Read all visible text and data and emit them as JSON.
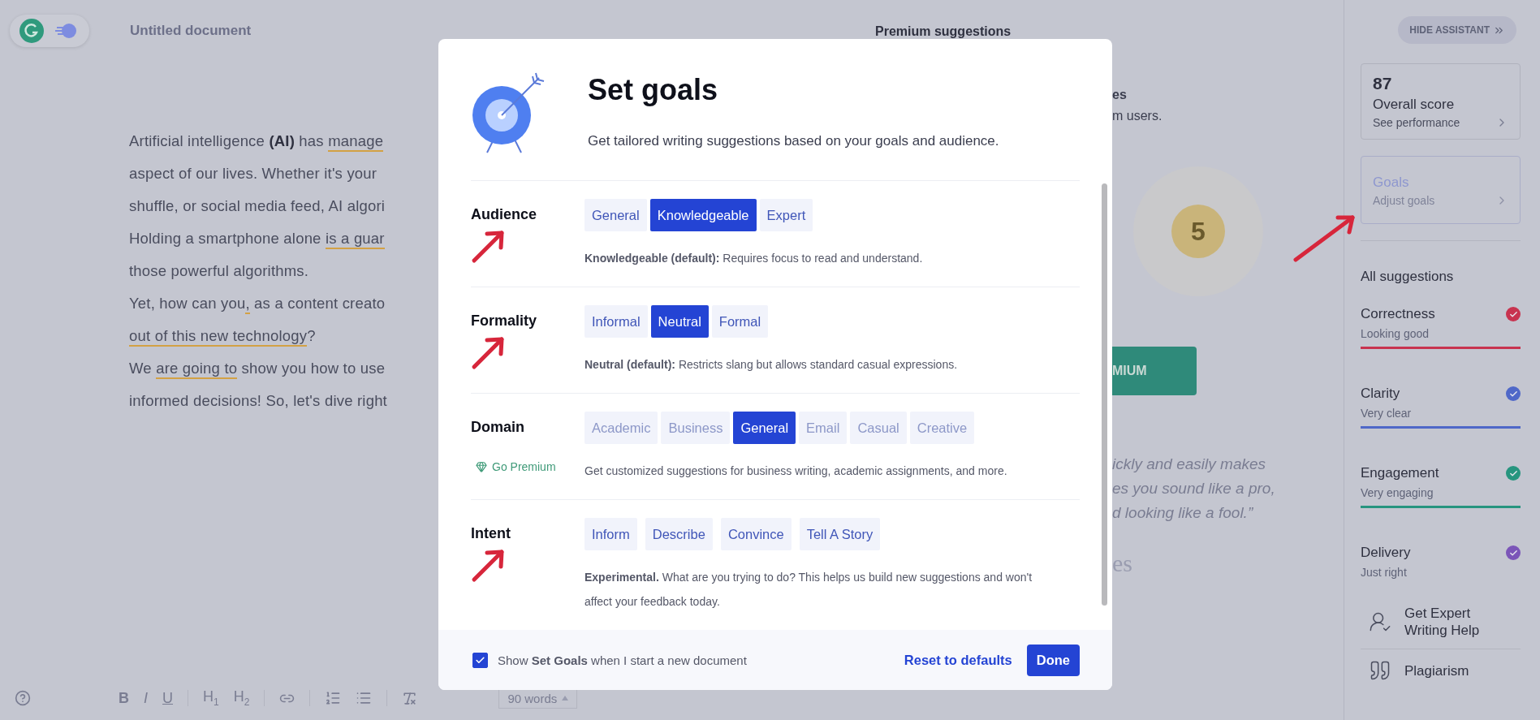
{
  "editor": {
    "document_title": "Untitled document",
    "lines": [
      [
        {
          "text": "Artificial intelligence **(AI)** has ",
          "flagged": false
        },
        {
          "text": "manage",
          "flagged": true
        }
      ],
      [
        {
          "text": "aspect of our lives. Whether it's your",
          "flagged": false
        }
      ],
      [
        {
          "text": "shuffle, or social media feed, AI algori",
          "flagged": false
        }
      ],
      [
        {
          "text": "Holding a smartphone alone ",
          "flagged": false
        },
        {
          "text": "is a guar",
          "flagged": true
        }
      ],
      [
        {
          "text": "those powerful algorithms.",
          "flagged": false
        }
      ],
      [
        {
          "text": "Yet, how can you",
          "flagged": false
        },
        {
          "text": ",",
          "flagged": true
        },
        {
          "text": " as a content creato",
          "flagged": false
        }
      ],
      [
        {
          "text": "out of this new technology",
          "flagged": true
        },
        {
          "text": "?",
          "flagged": false
        }
      ],
      [
        {
          "text": "We ",
          "flagged": false
        },
        {
          "text": "are going to",
          "flagged": true
        },
        {
          "text": " show you how to use",
          "flagged": false
        }
      ],
      [
        {
          "text": "informed decisions! So, let's dive right",
          "flagged": false
        }
      ]
    ],
    "format_buttons": [
      {
        "kind": "bold",
        "label": "B"
      },
      {
        "kind": "italic",
        "label": "I"
      },
      {
        "kind": "underline",
        "label": "U"
      },
      {
        "kind": "divider"
      },
      {
        "kind": "heading",
        "label": "H$_{1}$"
      },
      {
        "kind": "heading",
        "label": "H$_{2}$"
      },
      {
        "kind": "divider"
      },
      {
        "kind": "link"
      },
      {
        "kind": "divider"
      },
      {
        "kind": "numbered-list"
      },
      {
        "kind": "bullet-list"
      },
      {
        "kind": "divider"
      },
      {
        "kind": "clear"
      }
    ],
    "word_count": "90 words"
  },
  "premium_panel": {
    "heading": "Premium suggestions",
    "title_fragment": "es",
    "subtitle_fragment": "m users.",
    "count": "5",
    "button_fragment": "MIUM",
    "quote_lines": [
      "ickly and easily makes",
      "es you sound like a pro,",
      "d looking like a fool.”"
    ],
    "signature_fragment": "es"
  },
  "assistant": {
    "hide_button": "HIDE ASSISTANT",
    "score_card": {
      "score": "87",
      "label": "Overall score",
      "link": "See performance"
    },
    "goals_card": {
      "label": "Goals",
      "link": "Adjust goals",
      "annotated": true
    },
    "all_suggestions": "All suggestions",
    "categories": [
      {
        "name": "Correctness",
        "status": "Looking good",
        "color": "#c8334f",
        "underlined": true
      },
      {
        "name": "Clarity",
        "status": "Very clear",
        "color": "#4f68c8",
        "underlined": true
      },
      {
        "name": "Engagement",
        "status": "Very engaging",
        "color": "#27957f",
        "underlined": true
      },
      {
        "name": "Delivery",
        "status": "Just right",
        "color": "#7b55b8",
        "underlined": false
      }
    ],
    "extras": [
      {
        "kind": "expert",
        "label": "Get Expert Writing Help"
      },
      {
        "kind": "plagiarism",
        "label": "Plagiarism"
      }
    ]
  },
  "dialog": {
    "title": "Set goals",
    "subtitle": "Get tailored writing suggestions based on your goals and audience.",
    "sections": [
      {
        "label": "Audience",
        "kind": "joined",
        "disabled": false,
        "annotated": true,
        "options": [
          {
            "label": "General",
            "selected": false
          },
          {
            "label": "Knowledgeable",
            "selected": true
          },
          {
            "label": "Expert",
            "selected": false
          }
        ],
        "description": "**Knowledgeable (default):** Requires focus to read and understand."
      },
      {
        "label": "Formality",
        "kind": "joined",
        "disabled": false,
        "annotated": true,
        "options": [
          {
            "label": "Informal",
            "selected": false
          },
          {
            "label": "Neutral",
            "selected": true
          },
          {
            "label": "Formal",
            "selected": false
          }
        ],
        "description": "**Neutral (default):** Restricts slang but allows standard casual expressions."
      },
      {
        "label": "Domain",
        "kind": "joined",
        "disabled": true,
        "annotated": false,
        "premium_link": "Go Premium",
        "options": [
          {
            "label": "Academic",
            "selected": false
          },
          {
            "label": "Business",
            "selected": false
          },
          {
            "label": "General",
            "selected": true
          },
          {
            "label": "Email",
            "selected": false
          },
          {
            "label": "Casual",
            "selected": false
          },
          {
            "label": "Creative",
            "selected": false
          }
        ],
        "description": "Get customized suggestions for business writing, academic assignments, and more."
      },
      {
        "label": "Intent",
        "kind": "separate",
        "disabled": false,
        "annotated": true,
        "options": [
          {
            "label": "Inform",
            "selected": false
          },
          {
            "label": "Describe",
            "selected": false
          },
          {
            "label": "Convince",
            "selected": false
          },
          {
            "label": "Tell A Story",
            "selected": false
          }
        ],
        "description": "**Experimental.** What are you trying to do? This helps us build new suggestions and won't affect your feedback today."
      }
    ],
    "footer": {
      "checkbox_text": "Show **Set Goals** when I start a new document",
      "checked": true,
      "reset": "Reset to defaults",
      "done": "Done"
    }
  }
}
